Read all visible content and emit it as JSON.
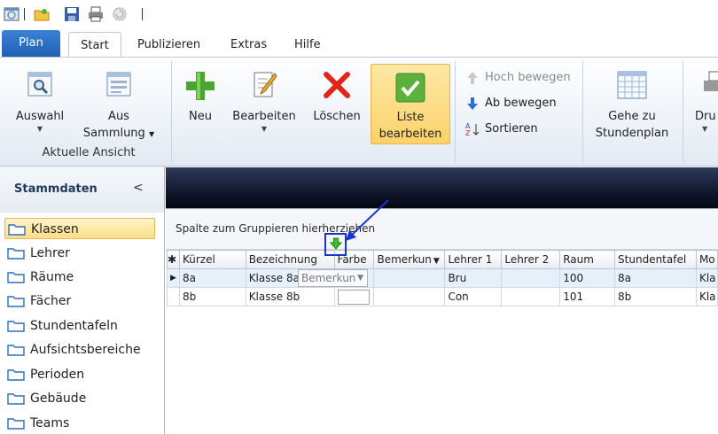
{
  "tabs": {
    "plan": "Plan",
    "items": [
      "Start",
      "Publizieren",
      "Extras",
      "Hilfe"
    ]
  },
  "ribbon": {
    "auswahl": "Auswahl",
    "aus_sammlung": [
      "Aus",
      "Sammlung"
    ],
    "group_aktuelle_ansicht": "Aktuelle Ansicht",
    "neu": "Neu",
    "bearbeiten": "Bearbeiten",
    "loeschen": "Löschen",
    "liste_bearbeiten": [
      "Liste",
      "bearbeiten"
    ],
    "hoch_bewegen": "Hoch bewegen",
    "ab_bewegen": "Ab bewegen",
    "sortieren": "Sortieren",
    "gehe_zu": [
      "Gehe zu",
      "Stundenplan"
    ],
    "drucken": "Dru"
  },
  "sidebar": {
    "title": "Stammdaten",
    "collapse": "<",
    "items": [
      "Klassen",
      "Lehrer",
      "Räume",
      "Fächer",
      "Stundentafeln",
      "Aufsichtsbereiche",
      "Perioden",
      "Gebäude",
      "Teams"
    ]
  },
  "grid": {
    "group_hint": "Spalte zum Gruppieren hierherziehen",
    "columns": [
      "Kürzel",
      "Bezeichnung",
      "Farbe",
      "Bemerkun",
      "Lehrer 1",
      "Lehrer 2",
      "Raum",
      "Stundentafel",
      "Mo"
    ],
    "rows": [
      [
        "8a",
        "Klasse 8a",
        "",
        "",
        "Bru",
        "",
        "100",
        "8a",
        "Kla"
      ],
      [
        "8b",
        "Klasse 8b",
        "",
        "",
        "Con",
        "",
        "101",
        "8b",
        "Kla"
      ]
    ],
    "drag_ghost": "Bemerkun"
  },
  "colors": {
    "accent_blue": "#1f5fb0",
    "selected_yellow": "#fbd26a",
    "drop_marker": "#1b33d1"
  }
}
